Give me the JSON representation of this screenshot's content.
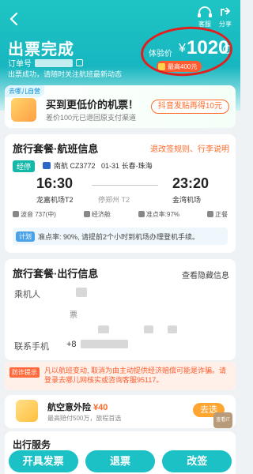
{
  "header": {
    "title": "出票完成",
    "order_label": "订单号",
    "notice": "出票成功，请随时关注航班最新动态",
    "service_label": "客服",
    "share_label": "分享",
    "price_label": "体验价",
    "currency": "¥",
    "price": "1020",
    "discount": "最高400元"
  },
  "promo": {
    "tag": "去哪儿自营",
    "title": "买到更低价的机票！",
    "subtitle": "差价100元已退回原支付渠道",
    "button": "抖音发贴再得10元"
  },
  "flight": {
    "title": "旅行套餐·航班信息",
    "link": "退改签规则、行李说明",
    "badge": "经停",
    "airline": "南航 CZ3772",
    "date_route": "01-31 长春-珠海",
    "dep_time": "16:30",
    "dep_airport": "龙嘉机场T2",
    "stop": "停郑州 T2",
    "arr_time": "23:20",
    "arr_airport": "金湾机场",
    "meta": [
      "波音 737(中)",
      "经济舱",
      "准点率:97%",
      "正餐"
    ],
    "plan_tag": "计划",
    "plan_text": "准点率: 90%, 请提前2个小时到机场办理登机手续。"
  },
  "trip": {
    "title": "旅行套餐·出行信息",
    "link": "查看隐藏信息",
    "passenger_label": "乘机人",
    "ticket_label": "票",
    "phone_label": "联系手机",
    "phone_prefix": "+8"
  },
  "fraud": {
    "tag": "防诈提示",
    "text": "凡以航班变动, 取消为由主动提供经济赔偿可能是诈骗。请登录去哪儿网核实或咨询客服95117。"
  },
  "insurance": {
    "title_prefix": "航空意外险",
    "price": "¥40",
    "subtitle": "最高赔付500万，旅程首选",
    "button": "去选",
    "side_button": "查看IT"
  },
  "services": {
    "title": "出行服务"
  },
  "bottom": {
    "invoice": "开具发票",
    "refund": "退票",
    "change": "改签"
  }
}
